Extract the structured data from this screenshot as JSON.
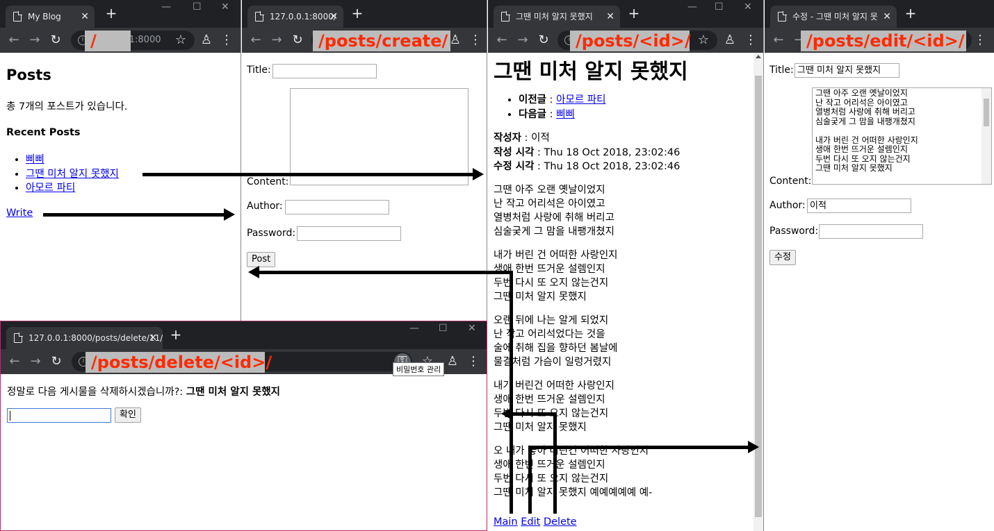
{
  "win1": {
    "tab_title": "My Blog",
    "url": "127.0.0.1:8000",
    "route": "/",
    "heading": "Posts",
    "count_text": "총 7개의 포스트가 있습니다.",
    "recent_heading": "Recent Posts",
    "posts": [
      "삐삐",
      "그땐 미처 알지 못했지",
      "아모르 파티"
    ],
    "write_link": "Write"
  },
  "win2": {
    "tab_title": "127.0.0.1:8000/",
    "route": "/posts/create/",
    "title_label": "Title:",
    "content_label": "Content:",
    "author_label": "Author:",
    "password_label": "Password:",
    "post_button": "Post"
  },
  "win3": {
    "tab_title": "그땐 미처 알지 못했지",
    "route": "/posts/<id>/",
    "title": "그땐 미처 알지 못했지",
    "prev_label": "이전글",
    "prev_link": "아모르 파티",
    "next_label": "다음글",
    "next_link": "삐삐",
    "author_label": "작성자",
    "author_value": " : 이적",
    "created_label": "작성 시각",
    "created_value": " : Thu 18 Oct 2018, 23:02:46",
    "modified_label": "수정 시각",
    "modified_value": " : Thu 18 Oct 2018, 23:02:46",
    "stanzas": [
      "그땐 아주 오랜 옛날이었지\n난 작고 어리석은 아이였고\n열병처럼 사랑에 취해 버리고\n심술궂게 그 맘을 내팽개쳤지",
      "내가 버린 건 어떠한 사랑인지\n생애 한번 뜨거운 설렘인지\n두번 다시 또 오지 않는건지\n그땐 미처 알지 못했지",
      "오랜 뒤에 나는 알게 되었지\n난 작고 어리석었다는 것을\n술에 취해 집을 향하던 봄날에\n물결처럼 가슴이 일렁거렸지",
      "내가 버린건 어떠한 사랑인지\n생애 한번 뜨거운 설렘인지\n두번 다시 또 오지 않는건지\n그땐 미처 알지 못했지",
      "오 내가 놓아 버린건 어떠한 사랑인지\n생애 한번 뜨거운 설렘인지\n두번 다시 또 오지 않는건지\n그땐 미처 알지 못했지 예예예예예 예-"
    ],
    "main_link": "Main",
    "edit_link": "Edit",
    "delete_link": "Delete"
  },
  "win4": {
    "tab_title": "수정 - 그땐 미처 알지 못",
    "route": "/posts/edit/<id>/",
    "title_label": "Title:",
    "title_value": "그땐 미처 알지 못했지",
    "content_label": "Content:",
    "content_value": "그땐 아주 오랜 옛날이었지\n난 작고 어리석은 아이였고\n열병처럼 사랑에 취해 버리고\n심술궂게 그 맘을 내팽개쳤지\n\n내가 버린 건 어떠한 사랑인지\n생애 한번 뜨거운 설렘인지\n두번 다시 또 오지 않는건지\n그땐 미처 알지 못했지",
    "author_label": "Author:",
    "author_value": "이적",
    "password_label": "Password:",
    "submit_button": "수정"
  },
  "win5": {
    "tab_title": "127.0.0.1:8000/posts/delete/11/",
    "route": "/posts/delete/<id>/",
    "tooltip": "비밀번호 관리",
    "confirm_text": "정말로 다음 게시물을 삭제하시겠습니까?: ",
    "confirm_title": "그땐 미처 알지 못했지",
    "confirm_button": "확인"
  }
}
